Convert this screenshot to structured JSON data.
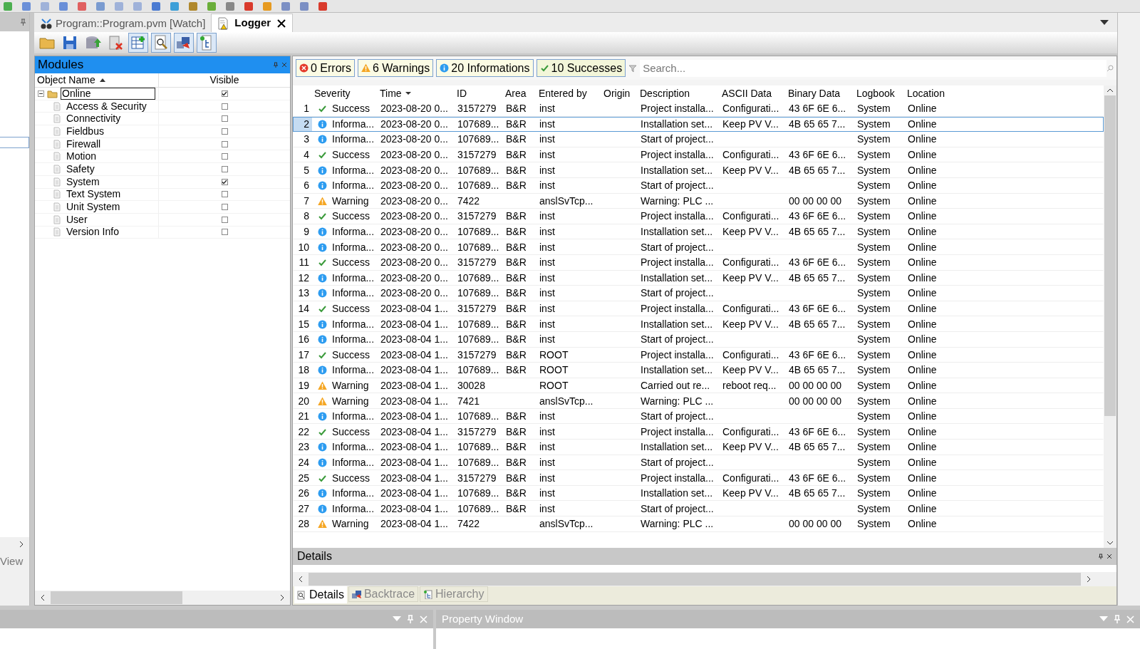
{
  "editor_tabs": [
    {
      "label": "Program::Program.pvm [Watch]",
      "kind": "watch",
      "selected": false
    },
    {
      "label": "Logger",
      "kind": "logger",
      "selected": true
    }
  ],
  "side_label": "View",
  "modules": {
    "title": "Modules",
    "columns": [
      "Object Name",
      "Visible"
    ],
    "tree": [
      {
        "name": "Online",
        "checked": true,
        "children": [
          {
            "name": "Access & Security",
            "checked": false
          },
          {
            "name": "Connectivity",
            "checked": false
          },
          {
            "name": "Fieldbus",
            "checked": false
          },
          {
            "name": "Firewall",
            "checked": false
          },
          {
            "name": "Motion",
            "checked": false
          },
          {
            "name": "Safety",
            "checked": false
          },
          {
            "name": "System",
            "checked": true
          },
          {
            "name": "Text System",
            "checked": false
          },
          {
            "name": "Unit System",
            "checked": false
          },
          {
            "name": "User",
            "checked": false
          },
          {
            "name": "Version Info",
            "checked": false
          }
        ]
      }
    ]
  },
  "filters": [
    {
      "label": "0 Errors",
      "kind": "error"
    },
    {
      "label": "6 Warnings",
      "kind": "warning"
    },
    {
      "label": "20 Informations",
      "kind": "info"
    },
    {
      "label": "10 Successes",
      "kind": "success"
    }
  ],
  "search": {
    "placeholder": "Search..."
  },
  "table": {
    "columns": [
      "Severity",
      "Time",
      "ID",
      "Area",
      "Entered by",
      "Origin",
      "Description",
      "ASCII Data",
      "Binary Data",
      "Logbook",
      "Location"
    ],
    "rows": [
      {
        "n": "1",
        "kind": "success",
        "severity": "Success",
        "time": "2023-08-20 0...",
        "id": "3157279",
        "area": "B&R",
        "entered_by": "inst",
        "description": "Project installa...",
        "ascii": "Configurati...",
        "binary": "43 6F 6E 6...",
        "logbook": "System",
        "location": "Online",
        "selected": false
      },
      {
        "n": "2",
        "kind": "info",
        "severity": "Informa...",
        "time": "2023-08-20 0...",
        "id": "107689...",
        "area": "B&R",
        "entered_by": "inst",
        "description": "Installation set...",
        "ascii": "Keep PV V...",
        "binary": "4B 65 65 7...",
        "logbook": "System",
        "location": "Online",
        "selected": true
      },
      {
        "n": "3",
        "kind": "info",
        "severity": "Informa...",
        "time": "2023-08-20 0...",
        "id": "107689...",
        "area": "B&R",
        "entered_by": "inst",
        "description": "Start of project...",
        "logbook": "System",
        "location": "Online",
        "selected": false
      },
      {
        "n": "4",
        "kind": "success",
        "severity": "Success",
        "time": "2023-08-20 0...",
        "id": "3157279",
        "area": "B&R",
        "entered_by": "inst",
        "description": "Project installa...",
        "ascii": "Configurati...",
        "binary": "43 6F 6E 6...",
        "logbook": "System",
        "location": "Online",
        "selected": false
      },
      {
        "n": "5",
        "kind": "info",
        "severity": "Informa...",
        "time": "2023-08-20 0...",
        "id": "107689...",
        "area": "B&R",
        "entered_by": "inst",
        "description": "Installation set...",
        "ascii": "Keep PV V...",
        "binary": "4B 65 65 7...",
        "logbook": "System",
        "location": "Online",
        "selected": false
      },
      {
        "n": "6",
        "kind": "info",
        "severity": "Informa...",
        "time": "2023-08-20 0...",
        "id": "107689...",
        "area": "B&R",
        "entered_by": "inst",
        "description": "Start of project...",
        "logbook": "System",
        "location": "Online",
        "selected": false
      },
      {
        "n": "7",
        "kind": "warning",
        "severity": "Warning",
        "time": "2023-08-20 0...",
        "id": "7422",
        "entered_by": "anslSvTcp...",
        "description": "Warning: PLC ...",
        "binary": "00 00 00 00",
        "logbook": "System",
        "location": "Online",
        "selected": false
      },
      {
        "n": "8",
        "kind": "success",
        "severity": "Success",
        "time": "2023-08-20 0...",
        "id": "3157279",
        "area": "B&R",
        "entered_by": "inst",
        "description": "Project installa...",
        "ascii": "Configurati...",
        "binary": "43 6F 6E 6...",
        "logbook": "System",
        "location": "Online",
        "selected": false
      },
      {
        "n": "9",
        "kind": "info",
        "severity": "Informa...",
        "time": "2023-08-20 0...",
        "id": "107689...",
        "area": "B&R",
        "entered_by": "inst",
        "description": "Installation set...",
        "ascii": "Keep PV V...",
        "binary": "4B 65 65 7...",
        "logbook": "System",
        "location": "Online",
        "selected": false
      },
      {
        "n": "10",
        "kind": "info",
        "severity": "Informa...",
        "time": "2023-08-20 0...",
        "id": "107689...",
        "area": "B&R",
        "entered_by": "inst",
        "description": "Start of project...",
        "logbook": "System",
        "location": "Online",
        "selected": false
      },
      {
        "n": "11",
        "kind": "success",
        "severity": "Success",
        "time": "2023-08-20 0...",
        "id": "3157279",
        "area": "B&R",
        "entered_by": "inst",
        "description": "Project installa...",
        "ascii": "Configurati...",
        "binary": "43 6F 6E 6...",
        "logbook": "System",
        "location": "Online",
        "selected": false
      },
      {
        "n": "12",
        "kind": "info",
        "severity": "Informa...",
        "time": "2023-08-20 0...",
        "id": "107689...",
        "area": "B&R",
        "entered_by": "inst",
        "description": "Installation set...",
        "ascii": "Keep PV V...",
        "binary": "4B 65 65 7...",
        "logbook": "System",
        "location": "Online",
        "selected": false
      },
      {
        "n": "13",
        "kind": "info",
        "severity": "Informa...",
        "time": "2023-08-20 0...",
        "id": "107689...",
        "area": "B&R",
        "entered_by": "inst",
        "description": "Start of project...",
        "logbook": "System",
        "location": "Online",
        "selected": false
      },
      {
        "n": "14",
        "kind": "success",
        "severity": "Success",
        "time": "2023-08-04 1...",
        "id": "3157279",
        "area": "B&R",
        "entered_by": "inst",
        "description": "Project installa...",
        "ascii": "Configurati...",
        "binary": "43 6F 6E 6...",
        "logbook": "System",
        "location": "Online",
        "selected": false
      },
      {
        "n": "15",
        "kind": "info",
        "severity": "Informa...",
        "time": "2023-08-04 1...",
        "id": "107689...",
        "area": "B&R",
        "entered_by": "inst",
        "description": "Installation set...",
        "ascii": "Keep PV V...",
        "binary": "4B 65 65 7...",
        "logbook": "System",
        "location": "Online",
        "selected": false
      },
      {
        "n": "16",
        "kind": "info",
        "severity": "Informa...",
        "time": "2023-08-04 1...",
        "id": "107689...",
        "area": "B&R",
        "entered_by": "inst",
        "description": "Start of project...",
        "logbook": "System",
        "location": "Online",
        "selected": false
      },
      {
        "n": "17",
        "kind": "success",
        "severity": "Success",
        "time": "2023-08-04 1...",
        "id": "3157279",
        "area": "B&R",
        "entered_by": "ROOT",
        "description": "Project installa...",
        "ascii": "Configurati...",
        "binary": "43 6F 6E 6...",
        "logbook": "System",
        "location": "Online",
        "selected": false
      },
      {
        "n": "18",
        "kind": "info",
        "severity": "Informa...",
        "time": "2023-08-04 1...",
        "id": "107689...",
        "area": "B&R",
        "entered_by": "ROOT",
        "description": "Installation set...",
        "ascii": "Keep PV V...",
        "binary": "4B 65 65 7...",
        "logbook": "System",
        "location": "Online",
        "selected": false
      },
      {
        "n": "19",
        "kind": "warning",
        "severity": "Warning",
        "time": "2023-08-04 1...",
        "id": "30028",
        "entered_by": "ROOT",
        "description": "Carried out re...",
        "ascii": "reboot req...",
        "binary": "00 00 00 00",
        "logbook": "System",
        "location": "Online",
        "selected": false
      },
      {
        "n": "20",
        "kind": "warning",
        "severity": "Warning",
        "time": "2023-08-04 1...",
        "id": "7421",
        "entered_by": "anslSvTcp...",
        "description": "Warning: PLC ...",
        "binary": "00 00 00 00",
        "logbook": "System",
        "location": "Online",
        "selected": false
      },
      {
        "n": "21",
        "kind": "info",
        "severity": "Informa...",
        "time": "2023-08-04 1...",
        "id": "107689...",
        "area": "B&R",
        "entered_by": "inst",
        "description": "Start of project...",
        "logbook": "System",
        "location": "Online",
        "selected": false
      },
      {
        "n": "22",
        "kind": "success",
        "severity": "Success",
        "time": "2023-08-04 1...",
        "id": "3157279",
        "area": "B&R",
        "entered_by": "inst",
        "description": "Project installa...",
        "ascii": "Configurati...",
        "binary": "43 6F 6E 6...",
        "logbook": "System",
        "location": "Online",
        "selected": false
      },
      {
        "n": "23",
        "kind": "info",
        "severity": "Informa...",
        "time": "2023-08-04 1...",
        "id": "107689...",
        "area": "B&R",
        "entered_by": "inst",
        "description": "Installation set...",
        "ascii": "Keep PV V...",
        "binary": "4B 65 65 7...",
        "logbook": "System",
        "location": "Online",
        "selected": false
      },
      {
        "n": "24",
        "kind": "info",
        "severity": "Informa...",
        "time": "2023-08-04 1...",
        "id": "107689...",
        "area": "B&R",
        "entered_by": "inst",
        "description": "Start of project...",
        "logbook": "System",
        "location": "Online",
        "selected": false
      },
      {
        "n": "25",
        "kind": "success",
        "severity": "Success",
        "time": "2023-08-04 1...",
        "id": "3157279",
        "area": "B&R",
        "entered_by": "inst",
        "description": "Project installa...",
        "ascii": "Configurati...",
        "binary": "43 6F 6E 6...",
        "logbook": "System",
        "location": "Online",
        "selected": false
      },
      {
        "n": "26",
        "kind": "info",
        "severity": "Informa...",
        "time": "2023-08-04 1...",
        "id": "107689...",
        "area": "B&R",
        "entered_by": "inst",
        "description": "Installation set...",
        "ascii": "Keep PV V...",
        "binary": "4B 65 65 7...",
        "logbook": "System",
        "location": "Online",
        "selected": false
      },
      {
        "n": "27",
        "kind": "info",
        "severity": "Informa...",
        "time": "2023-08-04 1...",
        "id": "107689...",
        "area": "B&R",
        "entered_by": "inst",
        "description": "Start of project...",
        "logbook": "System",
        "location": "Online",
        "selected": false
      },
      {
        "n": "28",
        "kind": "warning",
        "severity": "Warning",
        "time": "2023-08-04 1...",
        "id": "7422",
        "entered_by": "anslSvTcp...",
        "description": "Warning: PLC ...",
        "binary": "00 00 00 00",
        "logbook": "System",
        "location": "Online",
        "selected": false
      }
    ]
  },
  "details": {
    "title": "Details",
    "tabs": [
      {
        "label": "Details",
        "kind": "details",
        "selected": true
      },
      {
        "label": "Backtrace",
        "kind": "backtrace",
        "selected": false
      },
      {
        "label": "Hierarchy",
        "kind": "hierarchy",
        "selected": false
      }
    ]
  },
  "property_window": {
    "title": "Property Window"
  }
}
